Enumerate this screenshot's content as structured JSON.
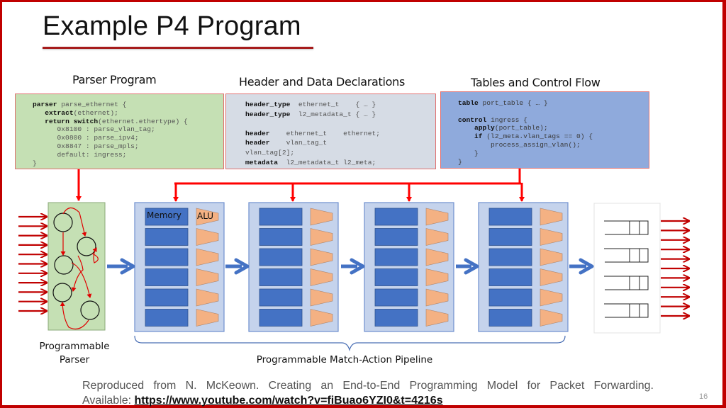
{
  "slide": {
    "title": "Example P4 Program",
    "page_number": "16"
  },
  "sections": {
    "parser_program": "Parser Program",
    "header_decls": "Header and Data Declarations",
    "tables_control": "Tables and Control Flow"
  },
  "code": {
    "parser": [
      [
        {
          "b": "parser"
        },
        {
          "t": " parse_ethernet {"
        }
      ],
      [
        {
          "t": "   "
        },
        {
          "b": "extract"
        },
        {
          "t": "(ethernet);"
        }
      ],
      [
        {
          "t": "   "
        },
        {
          "b": "return switch"
        },
        {
          "t": "(ethernet.ethertype) {"
        }
      ],
      [
        {
          "t": "      0x8100 : parse_vlan_tag;"
        }
      ],
      [
        {
          "t": "      0x0800 : parse_ipv4;"
        }
      ],
      [
        {
          "t": "      0x8847 : parse_mpls;"
        }
      ],
      [
        {
          "t": "      default: ingress;"
        }
      ],
      [
        {
          "t": "}"
        }
      ]
    ],
    "headers": [
      [
        {
          "b": "header_type"
        },
        {
          "t": "  ethernet_t    { … }"
        }
      ],
      [
        {
          "b": "header_type"
        },
        {
          "t": "  l2_metadata_t { … }"
        }
      ],
      [
        {
          "t": " "
        }
      ],
      [
        {
          "b": "header"
        },
        {
          "t": "    ethernet_t    ethernet;"
        }
      ],
      [
        {
          "b": "header"
        },
        {
          "t": "    vlan_tag_t"
        }
      ],
      [
        {
          "t": "vlan_tag[2];"
        }
      ],
      [
        {
          "b": "metadata"
        },
        {
          "t": "  l2_metadata_t l2_meta;"
        }
      ]
    ],
    "control": [
      [
        {
          "b": "table"
        },
        {
          "t": " port_table { … }"
        }
      ],
      [
        {
          "t": " "
        }
      ],
      [
        {
          "b": "control"
        },
        {
          "t": " ingress {"
        }
      ],
      [
        {
          "t": "    "
        },
        {
          "b": "apply"
        },
        {
          "t": "(port_table);"
        }
      ],
      [
        {
          "t": "    "
        },
        {
          "b": "if"
        },
        {
          "t": " (l2_meta.vlan_tags == 0) {"
        }
      ],
      [
        {
          "t": "        process_assign_vlan();"
        }
      ],
      [
        {
          "t": "    }"
        }
      ],
      [
        {
          "t": "}"
        }
      ]
    ]
  },
  "pipeline": {
    "memory_label": "Memory",
    "alu_label": "ALU",
    "stages": 4,
    "tables_per_stage": 6,
    "queues": 4,
    "input_arrows": 11,
    "output_arrows": 11
  },
  "labels": {
    "parser_line1": "Programmable",
    "parser_line2": "Parser",
    "pipeline": "Programmable Match-Action Pipeline"
  },
  "footer": {
    "citation": "Reproduced from N. McKeown. Creating an End-to-End Programming Model for Packet Forwarding.",
    "available_prefix": "Available: ",
    "link": "https://www.youtube.com/watch?v=fiBuao6YZI0&t=4216s"
  },
  "colors": {
    "frame_red": "#c00000",
    "arrow_red": "#c00000",
    "connector_red": "#ff0000",
    "parser_green": "#c5e0b4",
    "decl_gray": "#d6dce5",
    "control_blue": "#8faadc",
    "stage_bg": "#c5d3ec",
    "memory_blue": "#4472c4",
    "alu_orange": "#f4b183",
    "flow_arrow": "#4472c4"
  }
}
